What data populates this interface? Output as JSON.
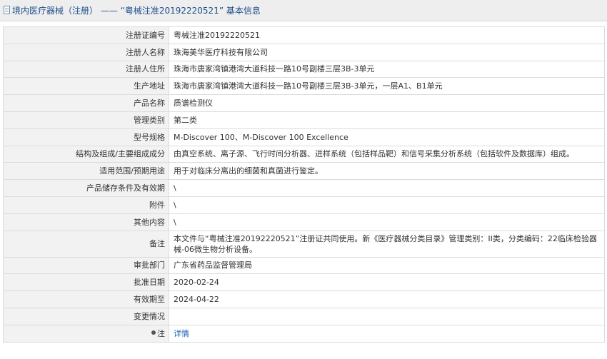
{
  "header": {
    "title": "境内医疗器械（注册）  ——  “粤械注准20192220521”  基本信息"
  },
  "rows": [
    {
      "label": "注册证编号",
      "value": "粤械注准20192220521"
    },
    {
      "label": "注册人名称",
      "value": "珠海美华医疗科技有限公司"
    },
    {
      "label": "注册人住所",
      "value": "珠海市唐家湾镇港湾大道科技一路10号副楼三层3B-3单元"
    },
    {
      "label": "生产地址",
      "value": "珠海市唐家湾镇港湾大道科技一路10号副楼三层3B-3单元，一层A1、B1单元"
    },
    {
      "label": "产品名称",
      "value": "质谱检测仪"
    },
    {
      "label": "管理类别",
      "value": "第二类"
    },
    {
      "label": "型号规格",
      "value": "M-Discover 100、M-Discover 100 Excellence"
    },
    {
      "label": "结构及组成/主要组成成分",
      "value": "由真空系统、离子源、飞行时间分析器、进样系统（包括样品靶）和信号采集分析系统（包括软件及数据库）组成。"
    },
    {
      "label": "适用范围/预期用途",
      "value": "用于对临床分离出的细菌和真菌进行鉴定。"
    },
    {
      "label": "产品储存条件及有效期",
      "value": "\\"
    },
    {
      "label": "附件",
      "value": "\\"
    },
    {
      "label": "其他内容",
      "value": "\\"
    },
    {
      "label": "备注",
      "value": "本文件与“粤械注准20192220521”注册证共同使用。新《医疗器械分类目录》管理类别：II类，分类编码：22临床检验器械-06微生物分析设备。"
    },
    {
      "label": "审批部门",
      "value": "广东省药品监督管理局"
    },
    {
      "label": "批准日期",
      "value": "2020-02-24"
    },
    {
      "label": "有效期至",
      "value": "2024-04-22"
    },
    {
      "label": "变更情况",
      "value": ""
    }
  ],
  "note": {
    "label": "注",
    "link": "详情"
  },
  "icons": {
    "header": "document-icon",
    "note": "pin-icon"
  },
  "colors": {
    "title": "#1f4e8c",
    "link": "#1d5fb0",
    "label_bg": "#f2f2f2"
  }
}
